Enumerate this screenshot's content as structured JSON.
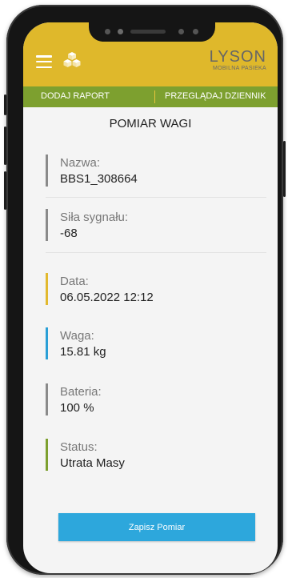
{
  "header": {
    "menu_icon": "hamburger-icon",
    "app_icon": "cubes-icon",
    "logo_text": "LYSON",
    "logo_subtitle": "MOBILNA PASIEKA",
    "background_color": "#dfb82b"
  },
  "tabs": [
    {
      "label": "DODAJ RAPORT"
    },
    {
      "label": "PRZEGLĄDAJ DZIENNIK"
    }
  ],
  "tabs_background_color": "#7da02f",
  "page_title": "POMIAR WAGI",
  "fields": [
    {
      "label": "Nazwa:",
      "value": "BBS1_308664",
      "accent": "#8a8a8a"
    },
    {
      "label": "Siła sygnału:",
      "value": "-68",
      "accent": "#8a8a8a"
    },
    {
      "label": "Data:",
      "value": "06.05.2022 12:12",
      "accent": "#e2b92f"
    },
    {
      "label": "Waga:",
      "value": "15.81 kg",
      "accent": "#2a9fd6"
    },
    {
      "label": "Bateria:",
      "value": "100 %",
      "accent": "#8a8a8a"
    },
    {
      "label": "Status:",
      "value": "Utrata Masy",
      "accent": "#7da02f"
    }
  ],
  "save_button": {
    "label": "Zapisz Pomiar",
    "color": "#2da7dc"
  }
}
